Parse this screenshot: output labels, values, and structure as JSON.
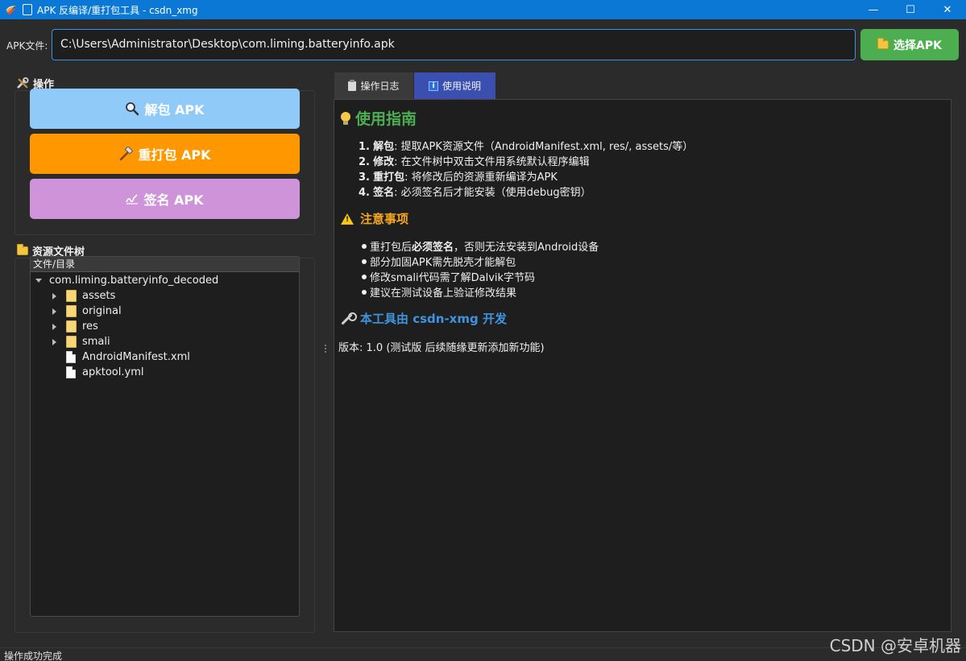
{
  "window": {
    "title": "APK 反编译/重打包工具 - csdn_xmg",
    "minimize": "—",
    "maximize": "☐",
    "close": "✕"
  },
  "file_row": {
    "label": "APK文件:",
    "value": "C:\\Users\\Administrator\\Desktop\\com.liming.batteryinfo.apk",
    "choose_button": "选择APK"
  },
  "actions": {
    "section_title": "操作",
    "unpack": "解包 APK",
    "repack": "重打包 APK",
    "sign": "签名 APK"
  },
  "tree": {
    "section_title": "资源文件树",
    "header": "文件/目录",
    "root": "com.liming.batteryinfo_decoded",
    "items": [
      {
        "name": "assets",
        "type": "folder"
      },
      {
        "name": "original",
        "type": "folder"
      },
      {
        "name": "res",
        "type": "folder"
      },
      {
        "name": "smali",
        "type": "folder"
      },
      {
        "name": "AndroidManifest.xml",
        "type": "file"
      },
      {
        "name": "apktool.yml",
        "type": "file"
      }
    ]
  },
  "tabs": {
    "log": "操作日志",
    "help": "使用说明"
  },
  "help": {
    "guide_title": "使用指南",
    "steps": [
      {
        "num": "1.",
        "key": "解包",
        "text": ": 提取APK资源文件（AndroidManifest.xml, res/, assets/等）"
      },
      {
        "num": "2.",
        "key": "修改",
        "text": ": 在文件树中双击文件用系统默认程序编辑"
      },
      {
        "num": "3.",
        "key": "重打包",
        "text": ": 将修改后的资源重新编译为APK"
      },
      {
        "num": "4.",
        "key": "签名",
        "text": ": 必须签名后才能安装（使用debug密钥）"
      }
    ],
    "notes_title": "注意事项",
    "notes": [
      {
        "pre": "重打包后",
        "bold": "必须签名",
        "post": "，否则无法安装到Android设备"
      },
      {
        "pre": "部分加固APK需先脱壳才能解包",
        "bold": "",
        "post": ""
      },
      {
        "pre": "修改smali代码需了解Dalvik字节码",
        "bold": "",
        "post": ""
      },
      {
        "pre": "建议在测试设备上验证修改结果",
        "bold": "",
        "post": ""
      }
    ],
    "dev_title": "本工具由 csdn-xmg 开发",
    "version": "版本: 1.0 (测试版 后续随缘更新添加新功能)"
  },
  "status": {
    "text": "操作成功完成"
  },
  "watermark": "CSDN @安卓机器",
  "colors": {
    "titlebar": "#0a78d4",
    "choose_button": "#4cae4f",
    "unpack_button": "#90caf9",
    "repack_button": "#ff9800",
    "sign_button": "#ce93d8",
    "guide_title": "#4caf50",
    "notes_title": "#f5a623",
    "dev_title": "#3f94e0",
    "active_tab": "#3a4fb0"
  }
}
